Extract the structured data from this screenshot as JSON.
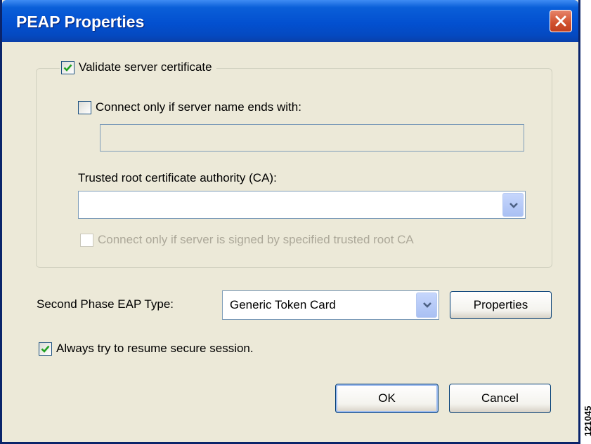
{
  "window": {
    "title": "PEAP Properties",
    "close_icon": "close-icon"
  },
  "validate_group": {
    "validate_label": "Validate server certificate",
    "validate_checked": true,
    "connect_if_name_label": "Connect only if server name ends with:",
    "connect_if_name_checked": false,
    "server_name_value": "",
    "trusted_root_label": "Trusted root certificate authority (CA):",
    "trusted_root_value": "",
    "signed_by_label": "Connect only if server is signed by specified trusted root CA",
    "signed_by_checked": false,
    "signed_by_disabled": true
  },
  "second_phase": {
    "label": "Second Phase EAP Type:",
    "selected": "Generic Token Card",
    "properties_button": "Properties"
  },
  "resume": {
    "label": "Always try to resume secure session.",
    "checked": true
  },
  "buttons": {
    "ok": "OK",
    "cancel": "Cancel"
  },
  "watermark": "121045",
  "colors": {
    "titlebar": "#0350d0",
    "dialog_bg": "#ece9d8",
    "close_button": "#d0502d",
    "checkmark": "#21a121",
    "disabled_text": "#aca899"
  }
}
